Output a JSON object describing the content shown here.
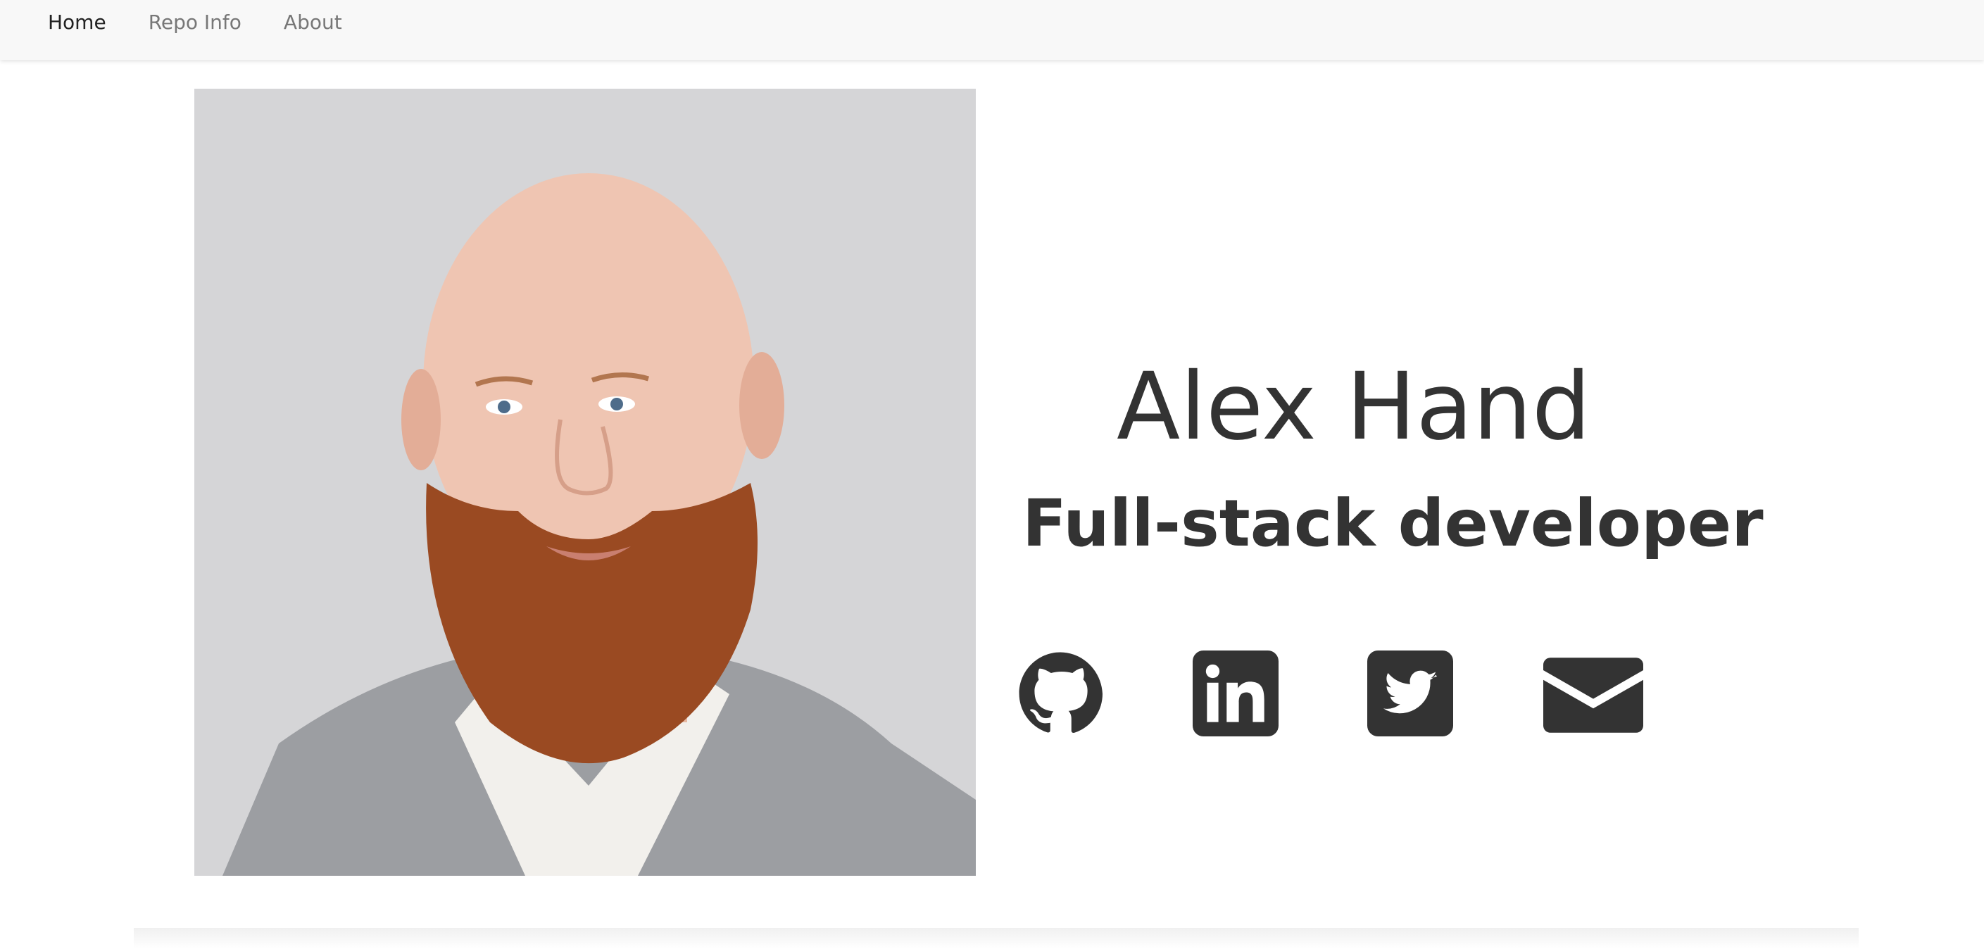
{
  "nav": {
    "links": [
      {
        "label": "Home",
        "active": true
      },
      {
        "label": "Repo Info",
        "active": false
      },
      {
        "label": "About",
        "active": false
      }
    ]
  },
  "profile": {
    "name": "Alex Hand",
    "title": "Full-stack developer",
    "photo_icon": "profile-photo"
  },
  "social": [
    {
      "icon": "github-icon"
    },
    {
      "icon": "linkedin-icon"
    },
    {
      "icon": "twitter-icon"
    },
    {
      "icon": "email-icon"
    }
  ],
  "colors": {
    "text": "#333333",
    "navbar": "#f8f8f8",
    "nav_inactive": "#777777",
    "nav_active": "#222222",
    "icon": "#333333",
    "photo_bg": "#d6d6d8"
  }
}
